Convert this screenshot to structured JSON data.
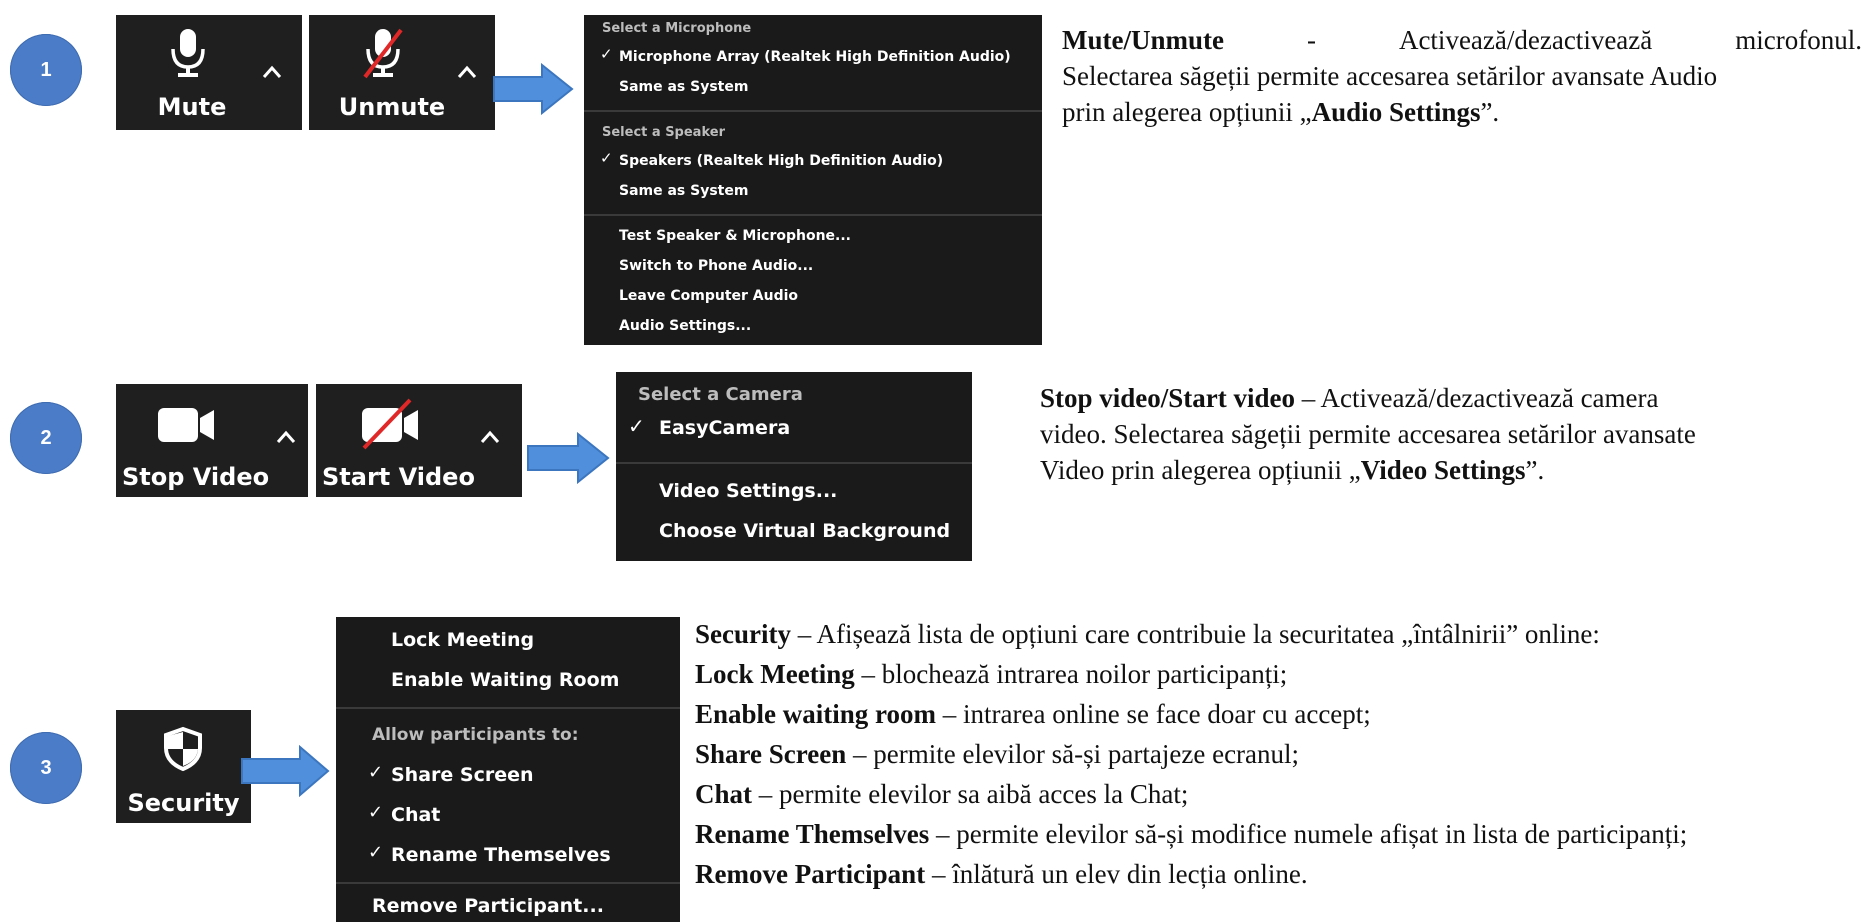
{
  "colors": {
    "step_blue": "#4a7cc7",
    "arrow_blue": "#4f8fdb",
    "zoom_dark": "#1f1f1f",
    "menu_dark": "#1a1a1a",
    "mute_red": "#e02828"
  },
  "row1": {
    "step": "1",
    "mute_label": "Mute",
    "unmute_label": "Unmute",
    "menu": {
      "mic_header": "Select a Microphone",
      "mic_items": [
        "Microphone Array (Realtek High Definition Audio)",
        "Same as System"
      ],
      "speaker_header": "Select a Speaker",
      "speaker_items": [
        "Speakers (Realtek High Definition Audio)",
        "Same as System"
      ],
      "actions": [
        "Test Speaker & Microphone...",
        "Switch to Phone Audio...",
        "Leave Computer Audio",
        "Audio Settings..."
      ]
    },
    "desc": {
      "term": "Mute/Unmute",
      "dash": "-",
      "w1": "Activează/dezactivează",
      "w2": "microfonul.",
      "line2": "Selectarea săgeții permite accesarea setărilor  avansate Audio",
      "line3_pre": "prin alegerea opțiunii „",
      "line3_bold": "Audio Settings",
      "line3_post": "”."
    }
  },
  "row2": {
    "step": "2",
    "stop_label": "Stop Video",
    "start_label": "Start Video",
    "menu": {
      "header": "Select a Camera",
      "camera": "EasyCamera",
      "actions": [
        "Video Settings...",
        "Choose Virtual Background"
      ]
    },
    "desc": {
      "term": "Stop video/Start video",
      "line1_rest": " – Activează/dezactivează camera",
      "line2": "video. Selectarea săgeții permite accesarea setărilor avansate",
      "line3_pre": "Video prin alegerea opțiunii „",
      "line3_bold": "Video Settings",
      "line3_post": "”."
    }
  },
  "row3": {
    "step": "3",
    "security_label": "Security",
    "menu": {
      "top_items": [
        "Lock Meeting",
        "Enable Waiting Room"
      ],
      "allow_header": "Allow participants to:",
      "allow_items": [
        "Share Screen",
        "Chat",
        "Rename Themselves"
      ],
      "remove": "Remove Participant..."
    },
    "desc": [
      {
        "term": "Security",
        "text": " – Afișează lista de opțiuni care contribuie la securitatea „întâlnirii” online:"
      },
      {
        "term": "Lock Meeting",
        "text": " – blochează intrarea noilor participanți;"
      },
      {
        "term": "Enable waiting room",
        "text": " – intrarea online se face doar cu accept;"
      },
      {
        "term": "Share Screen",
        "text": " – permite elevilor să-și partajeze ecranul;"
      },
      {
        "term": "Chat",
        "text": " – permite elevilor sa aibă acces la Chat;"
      },
      {
        "term": "Rename Themselves",
        "text": " – permite elevilor să-și modifice numele afișat in lista de participanți;"
      },
      {
        "term": "Remove Participant",
        "text": " – înlătură un elev din lecția online."
      }
    ]
  },
  "check_glyph": "✓"
}
